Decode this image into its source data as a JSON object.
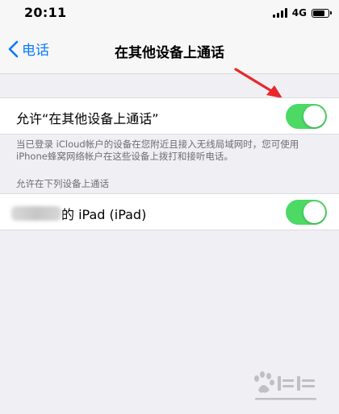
{
  "status_bar": {
    "time": "20:11",
    "network": "4G",
    "battery_level": 0.85
  },
  "nav_bar": {
    "back_label": "电话",
    "title": "在其他设备上通话"
  },
  "allow_calls": {
    "label": "允许“在其他设备上通话”",
    "enabled": true,
    "footer": "当已登录 iCloud帐户的设备在您附近且接入无线局域网时，您可使用 iPhone蜂窝网络帐户在这些设备上拨打和接听电话。"
  },
  "devices_section": {
    "header": "允许在下列设备上通话",
    "devices": [
      {
        "name_suffix": "的 iPad (iPad)",
        "enabled": true
      }
    ]
  },
  "colors": {
    "accent": "#0a7aff",
    "toggle_on": "#4cd964",
    "annotation": "#e8272a"
  },
  "icons": {
    "back": "chevron-left-icon",
    "signal": "cellular-signal-icon",
    "battery": "battery-icon"
  }
}
